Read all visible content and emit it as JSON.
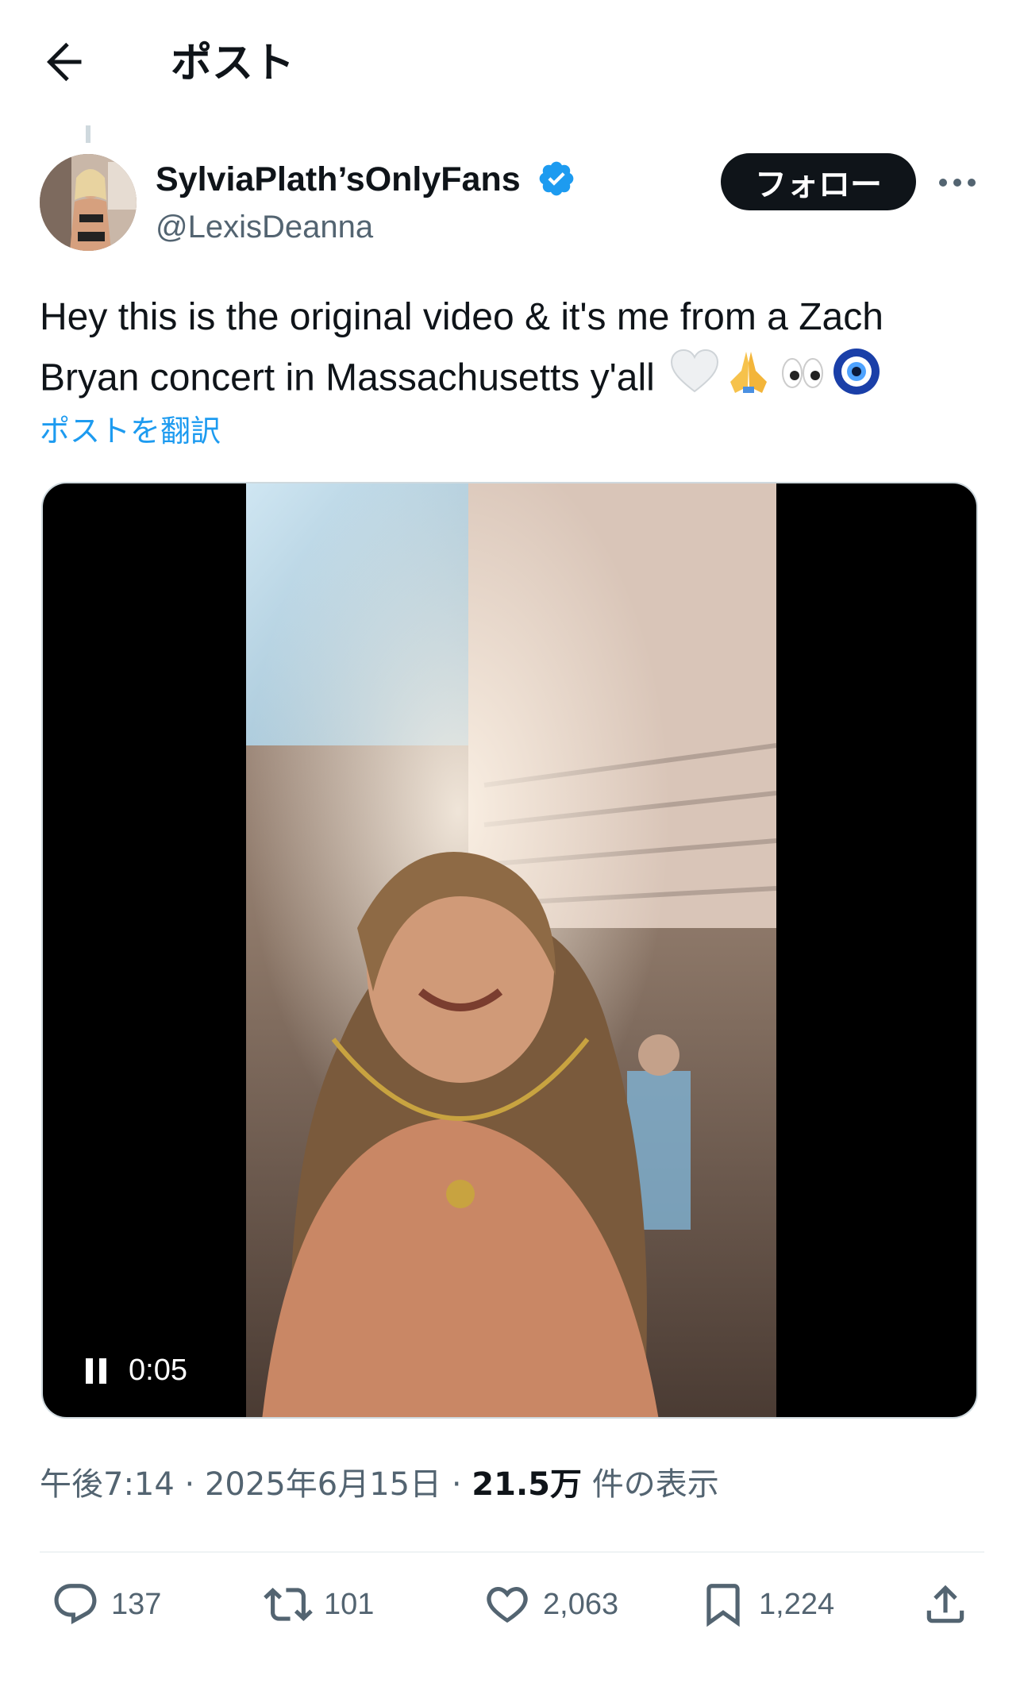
{
  "header": {
    "title": "ポスト"
  },
  "author": {
    "display_name": "SylviaPlath’sOnlyFans",
    "handle": "@LexisDeanna",
    "follow_label": "フォロー"
  },
  "post": {
    "text": "Hey this is the original video & it's me from a Zach Bryan concert in Massachusetts y'all",
    "emojis": [
      "🤍",
      "🙏",
      "👀",
      "🧿"
    ],
    "translate_label": "ポストを翻訳"
  },
  "video": {
    "elapsed": "0:05"
  },
  "meta": {
    "time": "午後7:14",
    "separator": "·",
    "date": "2025年6月15日",
    "views": "21.5万",
    "views_label": "件の表示"
  },
  "actions": {
    "replies": "137",
    "reposts": "101",
    "likes": "2,063",
    "bookmarks": "1,224"
  },
  "colors": {
    "accent": "#1d9bf0",
    "text": "#0f1419",
    "muted": "#536471"
  }
}
